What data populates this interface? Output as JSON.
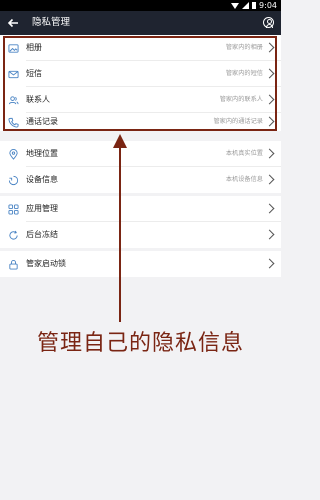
{
  "status_bar": {
    "time": "9:04"
  },
  "app_bar": {
    "title": "隐私管理"
  },
  "groups": [
    {
      "rows": [
        {
          "name": "album",
          "label": "相册",
          "subtitle": "管家内的相册"
        },
        {
          "name": "sms",
          "label": "短信",
          "subtitle": "管家内的短信"
        },
        {
          "name": "contacts",
          "label": "联系人",
          "subtitle": "管家内的联系人"
        },
        {
          "name": "call-log",
          "label": "通话记录",
          "subtitle": "管家内的通话记录"
        }
      ]
    },
    {
      "rows": [
        {
          "name": "location",
          "label": "地理位置",
          "subtitle": "本机真实位置"
        },
        {
          "name": "device-info",
          "label": "设备信息",
          "subtitle": "本机设备信息"
        }
      ]
    },
    {
      "rows": [
        {
          "name": "app-management",
          "label": "应用管理",
          "subtitle": ""
        },
        {
          "name": "background-freeze",
          "label": "后台冻结",
          "subtitle": ""
        }
      ]
    },
    {
      "rows": [
        {
          "name": "startup-lock",
          "label": "管家启动锁",
          "subtitle": ""
        }
      ]
    }
  ],
  "annotation": {
    "text": "管理自己的隐私信息",
    "color": "#7a2513"
  },
  "icons": {
    "album": "picture-icon",
    "sms": "envelope-icon",
    "contacts": "people-icon",
    "call-log": "phone-icon",
    "location": "location-pin-icon",
    "device-info": "device-icon",
    "app-management": "grid-icon",
    "background-freeze": "refresh-icon",
    "startup-lock": "lock-icon"
  }
}
